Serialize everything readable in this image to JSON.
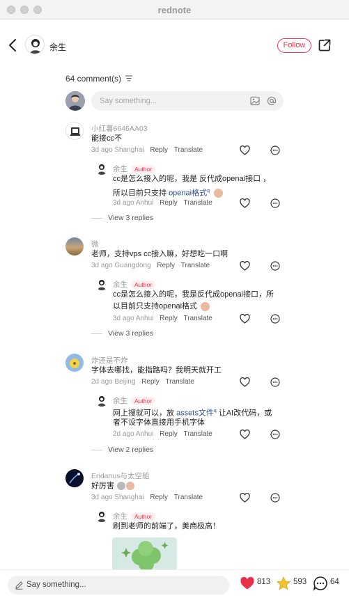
{
  "window": {
    "title": "rednote"
  },
  "header": {
    "author_name": "余生",
    "follow_label": "Follow"
  },
  "comments_header": {
    "count_label": "64 comment(s)"
  },
  "input": {
    "placeholder": "Say something..."
  },
  "labels": {
    "reply": "Reply",
    "translate": "Translate",
    "author_badge": "Author"
  },
  "threads": [
    {
      "user": "小红薯6646AA03",
      "text": "能接cc不",
      "meta": "3d ago Shanghai",
      "reply": {
        "user": "余生",
        "line1_pre": "cc是怎么接入的呢，我是 反代成openai接口 ，",
        "line2_pre": "所以目前只支持 ",
        "line2_link": "openai格式",
        "meta": "3d ago Anhui"
      },
      "view_replies": "View 3 replies"
    },
    {
      "user": "微",
      "text": "老师，支持vps cc接入嘛，好想吃一口啊",
      "meta": "3d ago Guangdong",
      "reply": {
        "user": "余生",
        "line1_pre": "cc是怎么接入的呢，我是反代成openai接口，所",
        "line2_pre": "以目前只支持openai格式",
        "line2_link": "",
        "meta": "3d ago Anhui"
      },
      "view_replies": "View 3 replies"
    },
    {
      "user": "炸还是不炸",
      "text": "字体去哪找，能指路吗？我明天就开工",
      "meta": "2d ago Beijing",
      "reply": {
        "user": "余生",
        "line1_pre": "网上搜就可以，放 ",
        "line1_link": "assets文件",
        "line1_post": " 让AI改代码，或",
        "line2_pre": "者不设字体直接用手机字体",
        "line2_link": "",
        "meta": "2d ago Anhui"
      },
      "view_replies": "View 2 replies"
    },
    {
      "user": "Eridanus与太空船",
      "text": "好厉害",
      "meta": "3d ago Shanghai",
      "reply": {
        "user": "余生",
        "line1_pre": "刷到老师的前端了，美商极高！"
      }
    }
  ],
  "bottom": {
    "placeholder": "Say something...",
    "likes": "813",
    "stars": "593",
    "comments": "64"
  },
  "colors": {
    "accent": "#ff2e4d",
    "star": "#f2c12e",
    "link": "#2a4f8a"
  },
  "icons": [
    "back-icon",
    "share-icon",
    "sort-icon",
    "image-icon",
    "at-icon",
    "heart-icon",
    "comment-icon",
    "pen-icon",
    "star-icon"
  ]
}
